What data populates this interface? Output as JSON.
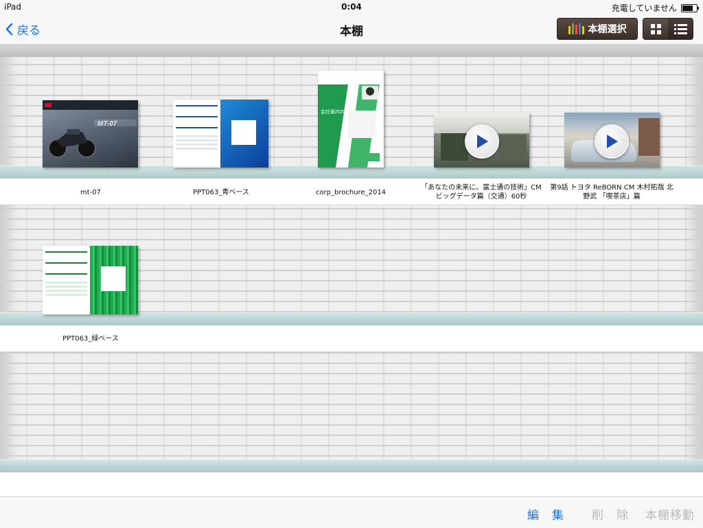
{
  "statusbar": {
    "device": "iPad",
    "time": "0:04",
    "charging": "充電していません",
    "battery_level": 0.85
  },
  "navbar": {
    "back_label": "戻る",
    "title": "本棚",
    "shelf_select_label": "本棚選択",
    "view_modes": [
      "grid",
      "list"
    ],
    "active_view": "grid"
  },
  "shelves": [
    {
      "items": [
        {
          "title": "mt-07",
          "kind": "catalog"
        },
        {
          "title": "PPT063_青ベース",
          "kind": "document"
        },
        {
          "title": "corp_brochure_2014",
          "kind": "brochure"
        },
        {
          "title": "「あなたの未来に。富士通の技術」CM ビッグデータ篇（交通）60秒",
          "kind": "video"
        },
        {
          "title": "第9話 トヨタ ReBORN CM 木村拓哉 北野武 「喫茶店」篇",
          "kind": "video"
        }
      ]
    },
    {
      "items": [
        {
          "title": "PPT063_緑ベース",
          "kind": "document"
        }
      ]
    },
    {
      "items": []
    }
  ],
  "covers": {
    "brochure_title": "会社案内2014",
    "play_icon": "play-icon"
  },
  "toolbar": {
    "edit_label": "編　集",
    "delete_label": "削　除",
    "move_label": "本棚移動"
  },
  "colors": {
    "accent": "#1a73e8",
    "disabled": "#b8b8b8",
    "shelf_glass": "#b7d2d2",
    "button_dark": "#3a2e2a"
  }
}
